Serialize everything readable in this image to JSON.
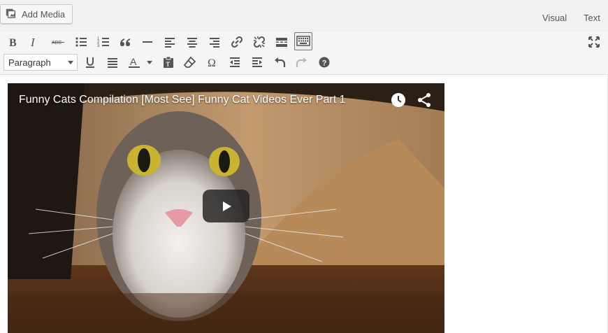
{
  "header": {
    "add_media_label": "Add Media",
    "tabs": [
      {
        "label": "Visual"
      },
      {
        "label": "Text"
      }
    ]
  },
  "toolbar": {
    "row1": [
      "bold-icon",
      "italic-icon",
      "strikethrough-icon",
      "bulleted-list-icon",
      "numbered-list-icon",
      "blockquote-icon",
      "horizontal-line-icon",
      "align-left-icon",
      "align-center-icon",
      "align-right-icon",
      "insert-link-icon",
      "remove-link-icon",
      "read-more-icon",
      "toolbar-toggle-icon"
    ],
    "row2": [
      "underline-icon",
      "justify-icon",
      "text-color-icon",
      "paste-as-text-icon",
      "clear-formatting-icon",
      "special-character-icon",
      "decrease-indent-icon",
      "increase-indent-icon",
      "undo-icon",
      "redo-icon",
      "help-icon"
    ],
    "format_select": {
      "selected": "Paragraph"
    },
    "distraction_free_icon": "fullscreen-icon",
    "active_button": "toolbar-toggle-icon"
  },
  "embed": {
    "title": "Funny Cats Compilation [Most See] Funny Cat Videos Ever Part 1",
    "icons": [
      "watch-later-icon",
      "share-icon",
      "play-icon"
    ]
  },
  "colors": {
    "toolbar_bg": "#f5f5f5",
    "icon": "#555555",
    "play_button_bg": "#212121"
  }
}
